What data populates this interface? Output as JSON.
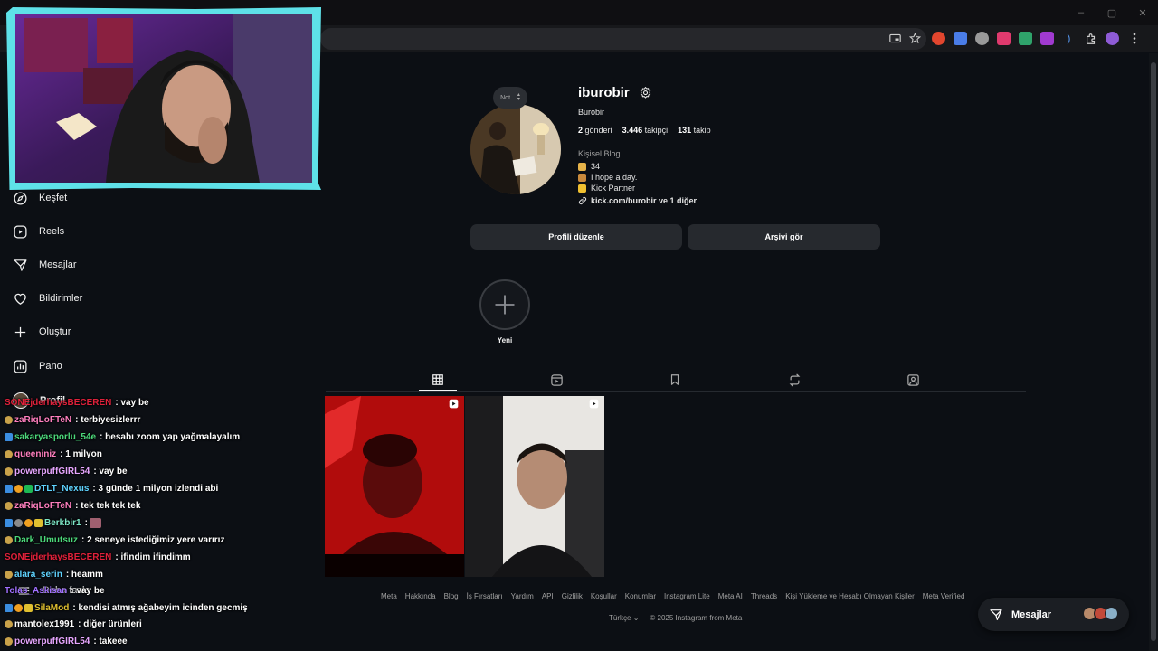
{
  "browser": {
    "window_controls": [
      "–",
      "▢",
      "✕"
    ],
    "extension_icons": [
      "pip-icon",
      "star-icon",
      "ext-red-icon",
      "translate-icon",
      "ext-gray-icon",
      "ext-pink-icon",
      "ext-green-icon",
      "ext-purple-icon",
      "ext-blue-icon",
      "puzzle-icon",
      "profile-icon",
      "menu-icon"
    ]
  },
  "sidebar": {
    "items": [
      {
        "label": "Keşfet",
        "icon": "compass-icon"
      },
      {
        "label": "Reels",
        "icon": "reels-icon"
      },
      {
        "label": "Mesajlar",
        "icon": "messenger-icon"
      },
      {
        "label": "Bildirimler",
        "icon": "heart-icon"
      },
      {
        "label": "Oluştur",
        "icon": "plus-icon"
      },
      {
        "label": "Pano",
        "icon": "chart-icon"
      },
      {
        "label": "Profil",
        "icon": "avatar-icon"
      }
    ],
    "more_label": "Daha fazla"
  },
  "profile": {
    "note": "Not...",
    "username": "iburobir",
    "full_name": "Burobir",
    "stats": {
      "posts_count": "2",
      "posts_label": "gönderi",
      "followers_count": "3.446",
      "followers_label": "takipçi",
      "following_count": "131",
      "following_label": "takip"
    },
    "category": "Kişisel Blog",
    "bio": [
      {
        "text": "34",
        "emoji_color": "#e7b44a"
      },
      {
        "text": "I hope a day.",
        "emoji_color": "#c98a3c"
      },
      {
        "text": "Kick Partner",
        "emoji_color": "#f0c030"
      }
    ],
    "link": "kick.com/burobir ve 1 diğer",
    "edit_button": "Profili düzenle",
    "archive_button": "Arşivi gör",
    "new_highlight_label": "Yeni"
  },
  "tabs": [
    "grid-icon",
    "reels-tab-icon",
    "saved-icon",
    "reposts-icon",
    "tagged-icon"
  ],
  "footer": {
    "links": [
      "Meta",
      "Hakkında",
      "Blog",
      "İş Fırsatları",
      "Yardım",
      "API",
      "Gizlilik",
      "Koşullar",
      "Konumlar",
      "Instagram Lite",
      "Meta AI",
      "Threads",
      "Kişi Yükleme ve Hesabı Olmayan Kişiler",
      "Meta Verified"
    ],
    "language": "Türkçe",
    "copyright": "© 2025 Instagram from Meta"
  },
  "messages_pill": {
    "label": "Mesajlar"
  },
  "chat": [
    {
      "user": "SONEjderhaysBECEREN",
      "color": "#e0213b",
      "badges": [],
      "message": ": vay be"
    },
    {
      "user": "zaRiqLoFTeN",
      "color": "#ff7fbf",
      "badges": [
        "#c9a24a"
      ],
      "message": ": terbiyesizlerrr"
    },
    {
      "user": "sakaryasporlu_54e",
      "color": "#4cd97b",
      "badges": [
        "#3b8de0"
      ],
      "message": ": hesabı zoom yap yağmalayalım"
    },
    {
      "user": "queeniniz",
      "color": "#ff7fbf",
      "badges": [
        "#c9a24a"
      ],
      "message": ": 1 milyon"
    },
    {
      "user": "powerpuffGIRL54",
      "color": "#e6a6ff",
      "badges": [
        "#c9a24a"
      ],
      "message": ": vay be"
    },
    {
      "user": "DTLT_Nexus",
      "color": "#5fd3ff",
      "badges": [
        "#3b8de0",
        "#f0a020",
        "#1db954"
      ],
      "message": ": 3 günde 1 milyon izlendi abi"
    },
    {
      "user": "zaRiqLoFTeN",
      "color": "#ff7fbf",
      "badges": [
        "#c9a24a"
      ],
      "message": ": tek tek tek tek"
    },
    {
      "user": "Berkbir1",
      "color": "#7ee8c8",
      "badges": [
        "#3b8de0",
        "#8a8a8a",
        "#f0a020",
        "#e0c030"
      ],
      "message": ":"
    },
    {
      "user": "Dark_Umutsuz",
      "color": "#4cd97b",
      "badges": [
        "#c9a24a"
      ],
      "message": ": 2 seneye istediğimiz yere varırız"
    },
    {
      "user": "SONEjderhaysBECEREN",
      "color": "#e0213b",
      "badges": [],
      "message": ": ifindim ifindimm"
    },
    {
      "user": "alara_serin",
      "color": "#5fd3ff",
      "badges": [
        "#c9a24a"
      ],
      "message": ": heamm"
    },
    {
      "user": "Tolas_Askisan",
      "color": "#a070ff",
      "badges": [],
      "message": ": vay be"
    },
    {
      "user": "SilaMod",
      "color": "#e0c030",
      "badges": [
        "#3b8de0",
        "#f0a020",
        "#e0c030"
      ],
      "message": ": kendisi atmış ağabeyim icinden gecmiş"
    },
    {
      "user": "mantolex1991",
      "color": "#ffffff",
      "badges": [
        "#c9a24a"
      ],
      "message": ": diğer ürünleri"
    },
    {
      "user": "powerpuffGIRL54",
      "color": "#e6a6ff",
      "badges": [
        "#c9a24a"
      ],
      "message": ": takeee"
    }
  ]
}
